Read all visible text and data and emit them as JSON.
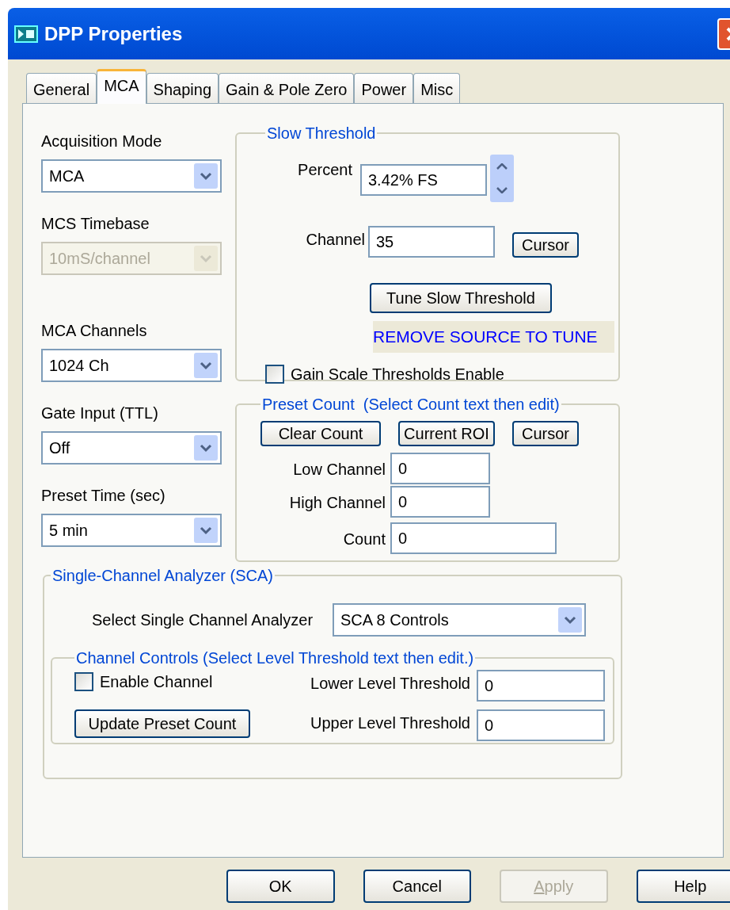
{
  "window": {
    "title": "DPP Properties"
  },
  "tabs": [
    {
      "label": "General",
      "selected": false
    },
    {
      "label": "MCA",
      "selected": true
    },
    {
      "label": "Shaping",
      "selected": false
    },
    {
      "label": "Gain & Pole Zero",
      "selected": false
    },
    {
      "label": "Power",
      "selected": false
    },
    {
      "label": "Misc",
      "selected": false
    }
  ],
  "left_fields": [
    {
      "label": "Acquisition Mode",
      "value": "MCA",
      "disabled": false
    },
    {
      "label": "MCS Timebase",
      "value": "10mS/channel",
      "disabled": true
    },
    {
      "label": "MCA Channels",
      "value": "1024 Ch",
      "disabled": false
    },
    {
      "label": "Gate Input (TTL)",
      "value": "Off",
      "disabled": false
    },
    {
      "label": "Preset Time (sec)",
      "value": "5 min",
      "disabled": false
    }
  ],
  "slow_threshold": {
    "title": "Slow Threshold",
    "percent": {
      "label": "Percent",
      "value": "3.42% FS"
    },
    "channel": {
      "label": "Channel",
      "value": "35"
    },
    "cursor_button": "Cursor",
    "tune_button": "Tune Slow Threshold",
    "notice": "REMOVE SOURCE TO TUNE",
    "gain_scale": {
      "label": "Gain Scale Thresholds Enable",
      "checked": false
    }
  },
  "preset_count": {
    "title": "Preset Count  (Select Count text then edit)",
    "buttons": [
      "Clear Count",
      "Current ROI",
      "Cursor"
    ],
    "fields": [
      {
        "label": "Low Channel",
        "value": "0"
      },
      {
        "label": "High Channel",
        "value": "0"
      },
      {
        "label": "Count",
        "value": "0"
      }
    ]
  },
  "sca": {
    "title": "Single-Channel Analyzer (SCA)",
    "select": {
      "label": "Select Single Channel Analyzer",
      "value": "SCA 8 Controls"
    },
    "channel_controls": {
      "title": "Channel Controls (Select Level Threshold text then edit.)",
      "enable": {
        "label": "Enable Channel",
        "checked": false
      },
      "update_button": "Update Preset Count",
      "fields": [
        {
          "label": "Lower Level Threshold",
          "value": "0"
        },
        {
          "label": "Upper Level Threshold",
          "value": "0"
        }
      ]
    }
  },
  "buttons": [
    {
      "label": "OK",
      "disabled": false
    },
    {
      "label": "Cancel",
      "disabled": false
    },
    {
      "label": "Apply",
      "disabled": true
    },
    {
      "label": "Help",
      "disabled": false
    }
  ]
}
